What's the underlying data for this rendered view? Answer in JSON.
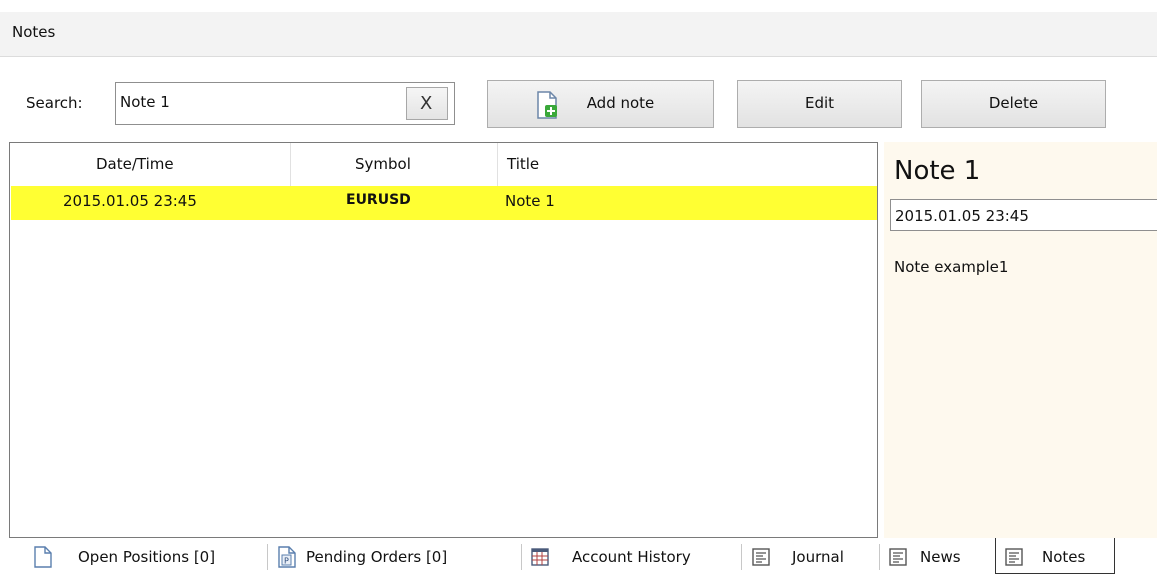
{
  "window": {
    "title": "Notes"
  },
  "search": {
    "label": "Search:",
    "value": "Note 1",
    "clear_label": "X"
  },
  "toolbar": {
    "add_label": "Add note",
    "edit_label": "Edit",
    "delete_label": "Delete"
  },
  "table": {
    "headers": [
      "Date/Time",
      "Symbol",
      "Title"
    ],
    "rows": [
      {
        "datetime": "2015.01.05 23:45",
        "symbol": "EURUSD",
        "title": "Note 1"
      }
    ]
  },
  "detail": {
    "title": "Note 1",
    "datetime": "2015.01.05 23:45",
    "body": "Note example1"
  },
  "tabs": [
    {
      "label": "Open Positions [0]",
      "icon": "document-icon"
    },
    {
      "label": "Pending Orders [0]",
      "icon": "pending-document-icon"
    },
    {
      "label": "Account History",
      "icon": "table-icon"
    },
    {
      "label": "Journal",
      "icon": "lines-icon"
    },
    {
      "label": "News",
      "icon": "lines-icon"
    },
    {
      "label": "Notes",
      "icon": "lines-icon",
      "active": true
    }
  ],
  "colors": {
    "selected_row": "#ffff33",
    "detail_bg": "#fef9ee",
    "add_icon_green": "#3aa83a"
  }
}
